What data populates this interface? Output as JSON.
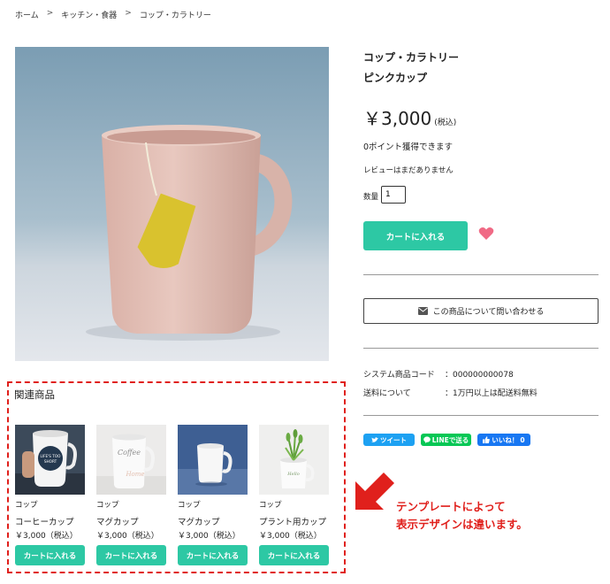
{
  "breadcrumb": {
    "home": "ホーム",
    "sep": ">",
    "category": "キッチン・食器",
    "subcategory": "コップ・カラトリー"
  },
  "product": {
    "category": "コップ・カラトリー",
    "name": "ピンクカップ",
    "price": "￥3,000",
    "tax_note": "(税込)",
    "points": "0ポイント獲得できます",
    "review": "レビューはまだありません",
    "qty_label": "数量",
    "qty_value": "1",
    "cart_button": "カートに入れる",
    "inquiry_button": "この商品について問い合わせる"
  },
  "specs": [
    {
      "key": "システム商品コード",
      "value": "：000000000078"
    },
    {
      "key": "送料について",
      "value": "：1万円以上は配送料無料"
    }
  ],
  "social": {
    "tweet": "ツイート",
    "line": "LINEで送る",
    "like": "いいね！",
    "like_count": "0"
  },
  "related": {
    "title": "関連商品",
    "items": [
      {
        "category": "コップ",
        "name": "コーヒーカップ",
        "price": "￥3,000（税込）",
        "button": "カートに入れる",
        "mug_text": "LIFE'S TOO SHORT"
      },
      {
        "category": "コップ",
        "name": "マグカップ",
        "price": "￥3,000（税込）",
        "button": "カートに入れる",
        "mug_text": "Coffee"
      },
      {
        "category": "コップ",
        "name": "マグカップ",
        "price": "￥3,000（税込）",
        "button": "カートに入れる"
      },
      {
        "category": "コップ",
        "name": "プラント用カップ",
        "price": "￥3,000（税込）",
        "button": "カートに入れる"
      }
    ]
  },
  "note": {
    "line1": "テンプレートによって",
    "line2": "表示デザインは違います。"
  },
  "colors": {
    "accent": "#2dc8a4",
    "heart": "#f06a85",
    "note_red": "#e0201c",
    "twitter": "#1da1f2",
    "line": "#06c755",
    "facebook": "#1877f2"
  }
}
